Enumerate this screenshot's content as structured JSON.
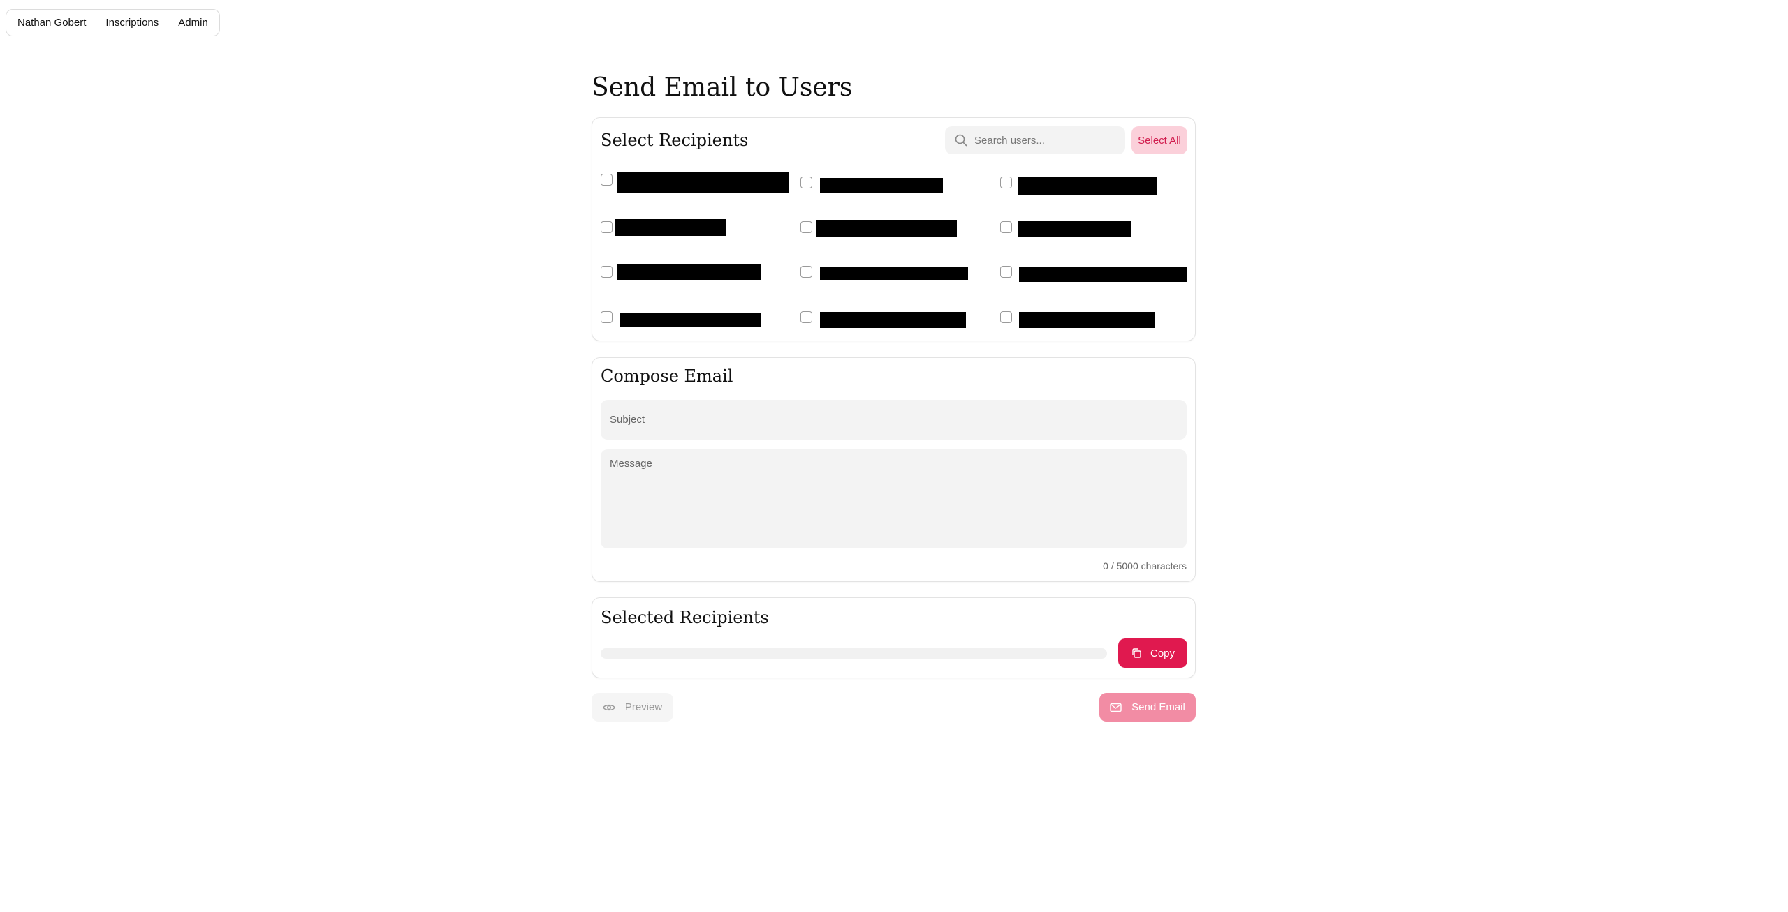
{
  "nav": {
    "items": [
      {
        "label": "Nathan Gobert"
      },
      {
        "label": "Inscriptions"
      },
      {
        "label": "Admin"
      }
    ]
  },
  "page": {
    "title": "Send Email to Users"
  },
  "recipients": {
    "title": "Select Recipients",
    "search_placeholder": "Search users...",
    "select_all_label": "Select All",
    "users": [
      {
        "name": "[redacted]",
        "checked": false
      },
      {
        "name": "[redacted]",
        "checked": false
      },
      {
        "name": "[redacted]",
        "checked": false
      },
      {
        "name": "[redacted]",
        "checked": false
      },
      {
        "name": "[redacted]",
        "checked": false
      },
      {
        "name": "[redacted]",
        "checked": false
      },
      {
        "name": "[redacted]",
        "checked": false
      },
      {
        "name": "[redacted]",
        "checked": false
      },
      {
        "name": "[redacted]",
        "checked": false
      },
      {
        "name": "[redacted]",
        "checked": false
      },
      {
        "name": "[redacted]",
        "checked": false
      },
      {
        "name": "[redacted]",
        "checked": false
      }
    ]
  },
  "compose": {
    "title": "Compose Email",
    "subject_placeholder": "Subject",
    "subject_value": "",
    "message_placeholder": "Message",
    "message_value": "",
    "char_count": "0 / 5000 characters"
  },
  "selected": {
    "title": "Selected Recipients",
    "copy_label": "Copy"
  },
  "actions": {
    "preview_label": "Preview",
    "send_label": "Send Email"
  },
  "colors": {
    "accent": "#e0194f",
    "accent_light": "#fbd0da",
    "send_disabled": "#f28ca4"
  },
  "icons": {
    "search": "search-icon",
    "copy": "copy-icon",
    "preview": "eye-icon",
    "send": "mail-icon"
  }
}
